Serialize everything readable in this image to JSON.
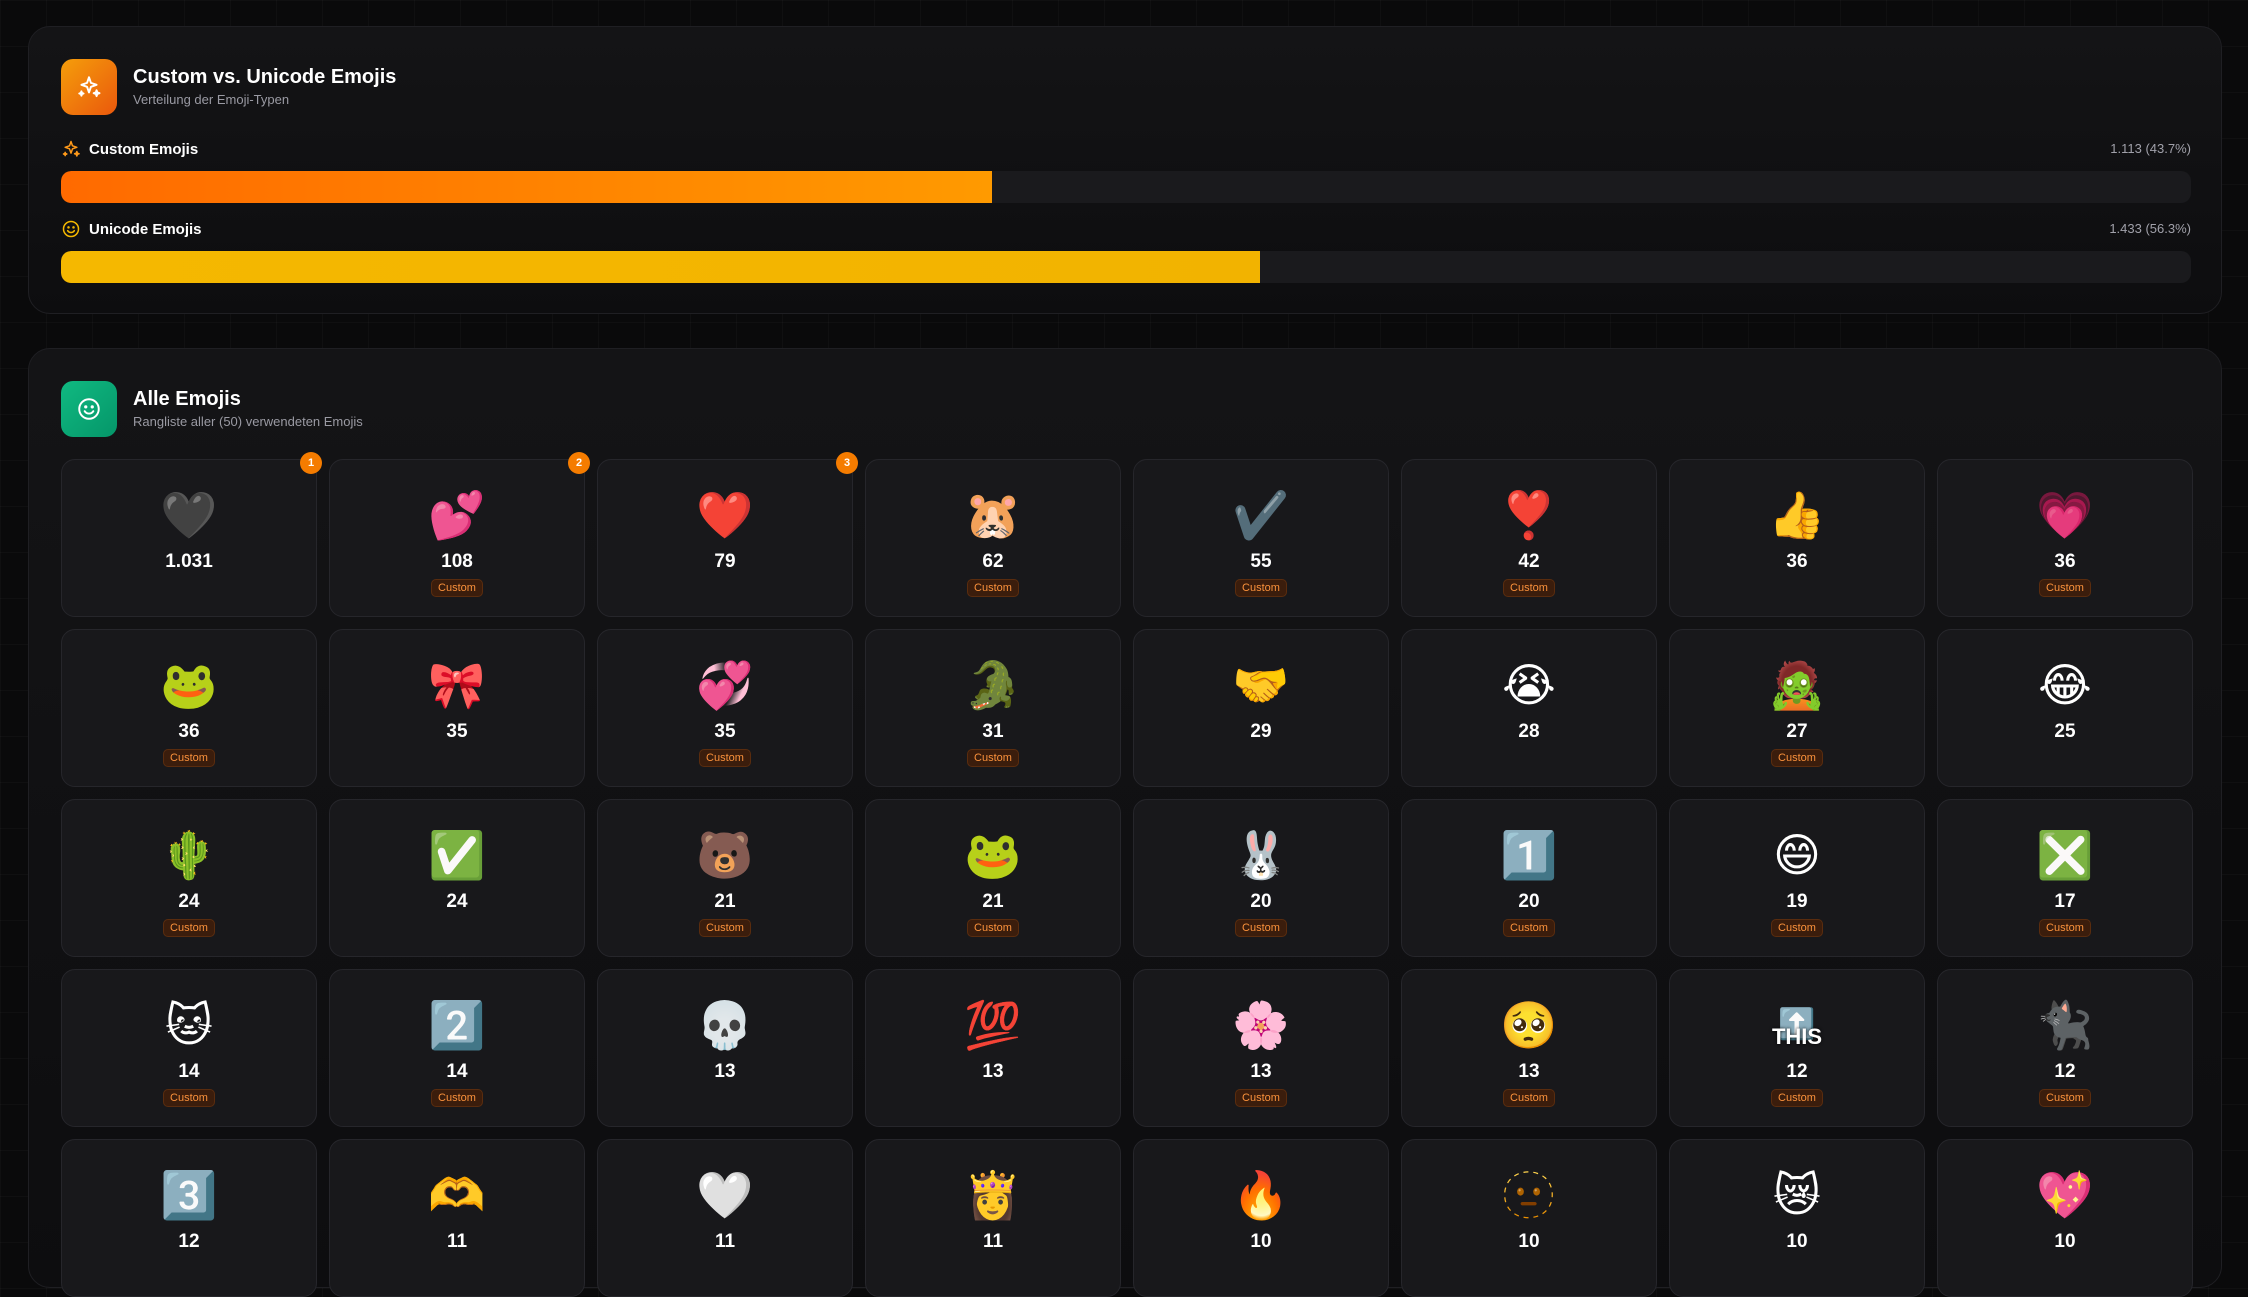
{
  "types_card": {
    "title": "Custom vs. Unicode Emojis",
    "subtitle": "Verteilung der Emoji-Typen",
    "rows": [
      {
        "label": "Custom Emojis",
        "value": "1.113 (43.7%)",
        "percent": 43.7,
        "icon": "sparkles-icon",
        "color": "#ff8800"
      },
      {
        "label": "Unicode Emojis",
        "value": "1.433 (56.3%)",
        "percent": 56.3,
        "icon": "smile-icon",
        "color": "#f5b800"
      }
    ]
  },
  "all_card": {
    "title": "Alle Emojis",
    "subtitle": "Rangliste aller (50) verwendeten Emojis",
    "badge_label": "Custom",
    "emojis": [
      {
        "glyph": "🖤",
        "count": "1.031",
        "custom": false,
        "rank": "1"
      },
      {
        "glyph": "💕",
        "count": "108",
        "custom": true,
        "rank": "2"
      },
      {
        "glyph": "❤️",
        "count": "79",
        "custom": false,
        "rank": "3"
      },
      {
        "glyph": "🐹",
        "count": "62",
        "custom": true
      },
      {
        "glyph": "✔️",
        "count": "55",
        "custom": true
      },
      {
        "glyph": "❣️",
        "count": "42",
        "custom": true
      },
      {
        "glyph": "👍",
        "count": "36",
        "custom": false
      },
      {
        "glyph": "💗",
        "count": "36",
        "custom": true
      },
      {
        "glyph": "🐸",
        "count": "36",
        "custom": true
      },
      {
        "glyph": "🎀",
        "count": "35",
        "custom": false
      },
      {
        "glyph": "💞",
        "count": "35",
        "custom": true
      },
      {
        "glyph": "🐊",
        "count": "31",
        "custom": true
      },
      {
        "glyph": "🤝",
        "count": "29",
        "custom": false
      },
      {
        "glyph": "😭",
        "count": "28",
        "custom": false
      },
      {
        "glyph": "🧟",
        "count": "27",
        "custom": true
      },
      {
        "glyph": "😂",
        "count": "25",
        "custom": false
      },
      {
        "glyph": "🌵",
        "count": "24",
        "custom": true
      },
      {
        "glyph": "✅",
        "count": "24",
        "custom": false
      },
      {
        "glyph": "🐻",
        "count": "21",
        "custom": true
      },
      {
        "glyph": "🐸",
        "count": "21",
        "custom": true
      },
      {
        "glyph": "🐰",
        "count": "20",
        "custom": true
      },
      {
        "glyph": "1️⃣",
        "count": "20",
        "custom": true
      },
      {
        "glyph": "😄",
        "count": "19",
        "custom": true
      },
      {
        "glyph": "❎",
        "count": "17",
        "custom": true
      },
      {
        "glyph": "🐱",
        "count": "14",
        "custom": true
      },
      {
        "glyph": "2️⃣",
        "count": "14",
        "custom": true
      },
      {
        "glyph": "💀",
        "count": "13",
        "custom": false
      },
      {
        "glyph": "💯",
        "count": "13",
        "custom": false
      },
      {
        "glyph": "🌸",
        "count": "13",
        "custom": true
      },
      {
        "glyph": "🥺",
        "count": "13",
        "custom": true
      },
      {
        "glyph": "⬆️",
        "count": "12",
        "custom": true,
        "caption": "THIS"
      },
      {
        "glyph": "🐈‍⬛",
        "count": "12",
        "custom": true
      },
      {
        "glyph": "3️⃣",
        "count": "12",
        "custom": false
      },
      {
        "glyph": "🫶",
        "count": "11",
        "custom": false
      },
      {
        "glyph": "🤍",
        "count": "11",
        "custom": false
      },
      {
        "glyph": "👸",
        "count": "11",
        "custom": false
      },
      {
        "glyph": "🔥",
        "count": "10",
        "custom": false
      },
      {
        "glyph": "🫥",
        "count": "10",
        "custom": false
      },
      {
        "glyph": "😿",
        "count": "10",
        "custom": false
      },
      {
        "glyph": "💖",
        "count": "10",
        "custom": false
      }
    ]
  }
}
